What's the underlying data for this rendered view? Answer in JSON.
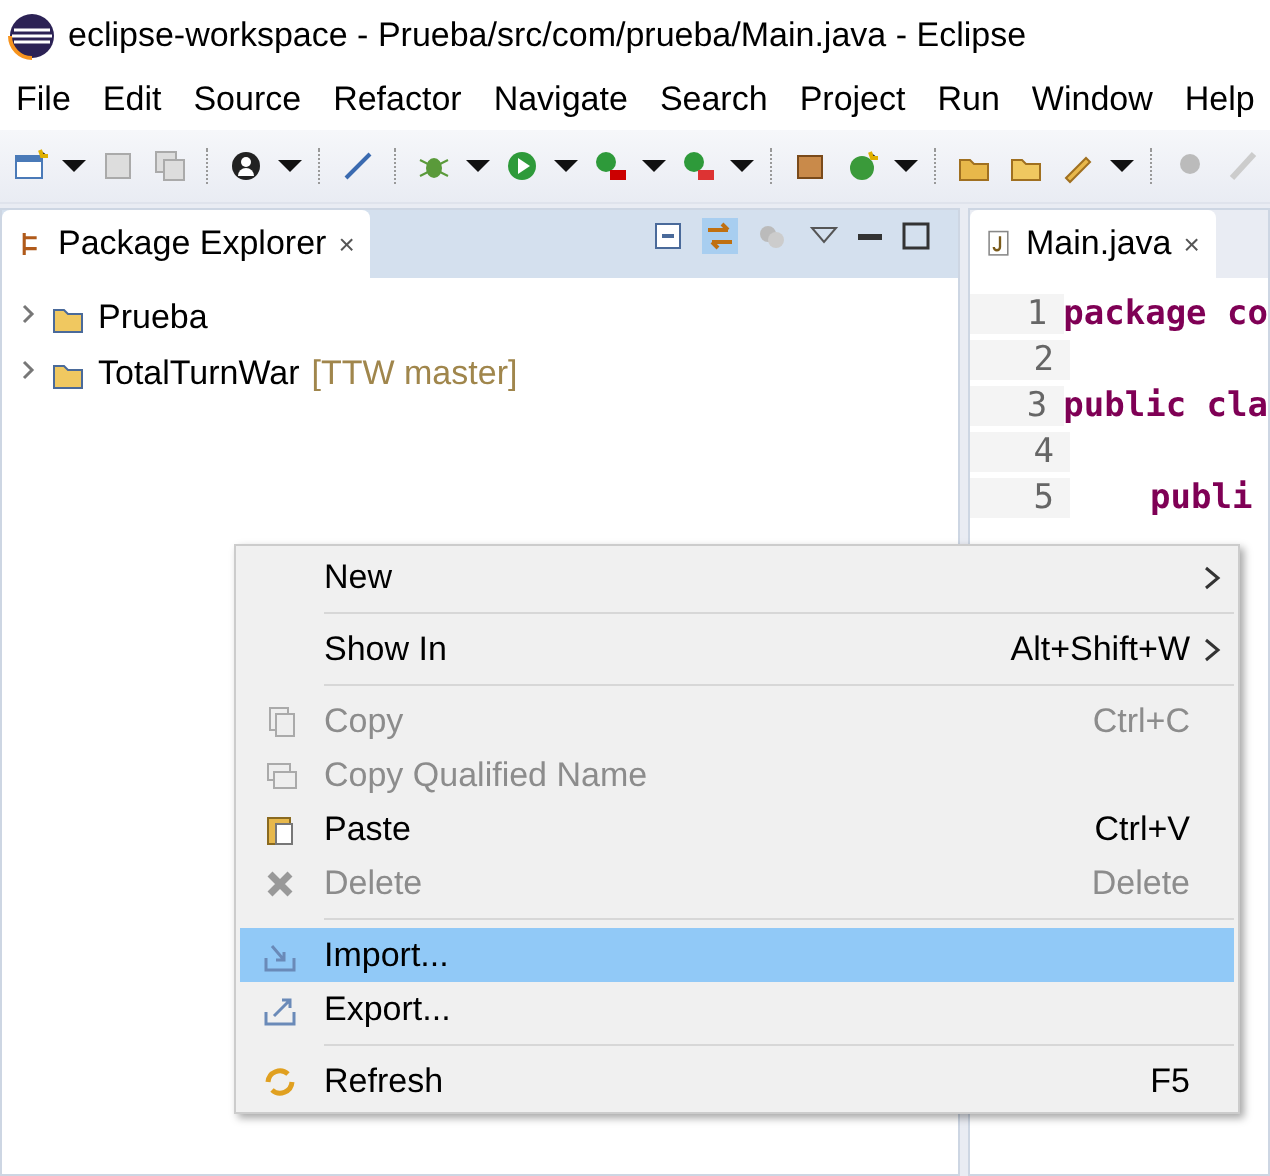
{
  "window": {
    "title": "eclipse-workspace - Prueba/src/com/prueba/Main.java - Eclipse"
  },
  "menu_bar": [
    "File",
    "Edit",
    "Source",
    "Refactor",
    "Navigate",
    "Search",
    "Project",
    "Run",
    "Window",
    "Help"
  ],
  "package_explorer": {
    "title": "Package Explorer",
    "close": "×",
    "items": [
      {
        "name": "Prueba",
        "expanded": false
      },
      {
        "name": "TotalTurnWar",
        "decoration": "[TTW master]",
        "expanded": false
      }
    ]
  },
  "editor": {
    "tab": "Main.java",
    "close": "×",
    "lines": [
      {
        "number": "1",
        "code": "package co"
      },
      {
        "number": "2"
      },
      {
        "number": "3",
        "code": "public cla"
      },
      {
        "number": "4"
      },
      {
        "number": "5",
        "code": "publi"
      }
    ]
  },
  "context_menu": [
    {
      "kind": "item",
      "label": "New",
      "submenu": true,
      "disabled": false,
      "selected": false
    },
    {
      "kind": "separator"
    },
    {
      "kind": "item",
      "label": "Show In",
      "shortcut": "Alt+Shift+W",
      "submenu": true,
      "disabled": false,
      "selected": false
    },
    {
      "kind": "separator"
    },
    {
      "kind": "item",
      "label": "Copy",
      "shortcut": "Ctrl+C",
      "submenu": false,
      "disabled": true,
      "selected": false
    },
    {
      "kind": "item",
      "label": "Copy Qualified Name",
      "submenu": false,
      "disabled": true,
      "selected": false
    },
    {
      "kind": "item",
      "label": "Paste",
      "shortcut": "Ctrl+V",
      "submenu": false,
      "disabled": false,
      "selected": false
    },
    {
      "kind": "item",
      "label": "Delete",
      "shortcut": "Delete",
      "submenu": false,
      "disabled": true,
      "selected": false
    },
    {
      "kind": "separator"
    },
    {
      "kind": "item",
      "label": "Import...",
      "submenu": false,
      "disabled": false,
      "selected": true
    },
    {
      "kind": "item",
      "label": "Export...",
      "submenu": false,
      "disabled": false,
      "selected": false
    },
    {
      "kind": "separator"
    },
    {
      "kind": "item",
      "label": "Refresh",
      "shortcut": "F5",
      "submenu": false,
      "disabled": false,
      "selected": false
    }
  ]
}
